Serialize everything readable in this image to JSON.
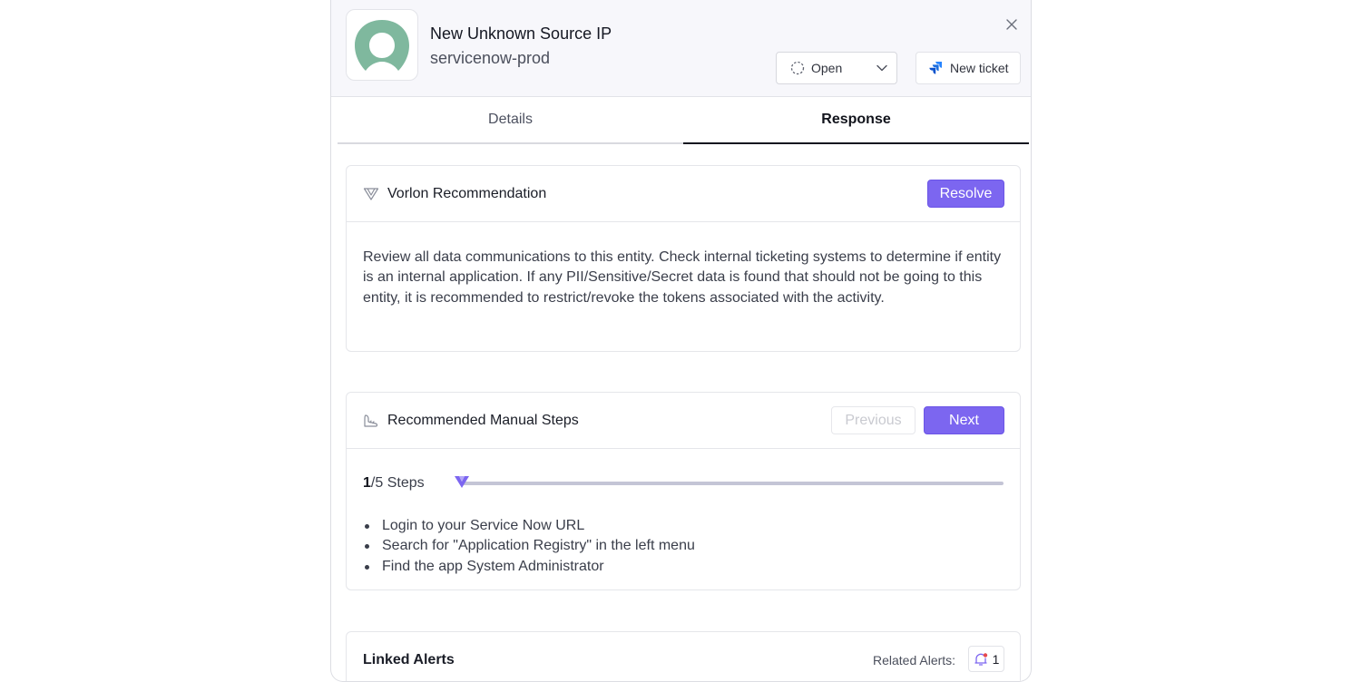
{
  "header": {
    "title": "New Unknown Source IP",
    "subtitle": "servicenow-prod",
    "status": {
      "label": "Open",
      "icon": "dashed-circle-icon"
    },
    "new_ticket_label": "New ticket",
    "logo_color": "#7fb89e"
  },
  "tabs": [
    {
      "label": "Details",
      "active": false
    },
    {
      "label": "Response",
      "active": true
    }
  ],
  "recommendation": {
    "title": "Vorlon Recommendation",
    "resolve_label": "Resolve",
    "text": "Review all data communications to this entity. Check internal ticketing systems to determine if entity is an internal application. If any PII/Sensitive/Secret data is found that should not be going to this entity, it is recommended to restrict/revoke the tokens associated with the activity."
  },
  "manual_steps": {
    "title": "Recommended Manual Steps",
    "previous_label": "Previous",
    "next_label": "Next",
    "current_step": "1",
    "total_steps": "/5 Steps",
    "progress_fraction": 0.2,
    "items": [
      "Login to your Service Now URL",
      "Search for \"Application Registry\" in the left menu",
      "Find the app System Administrator"
    ]
  },
  "linked_alerts": {
    "title": "Linked Alerts",
    "related_label": "Related Alerts:",
    "related_count": "1"
  },
  "colors": {
    "accent": "#7c66f0",
    "progress_track": "#c4c5d6"
  }
}
